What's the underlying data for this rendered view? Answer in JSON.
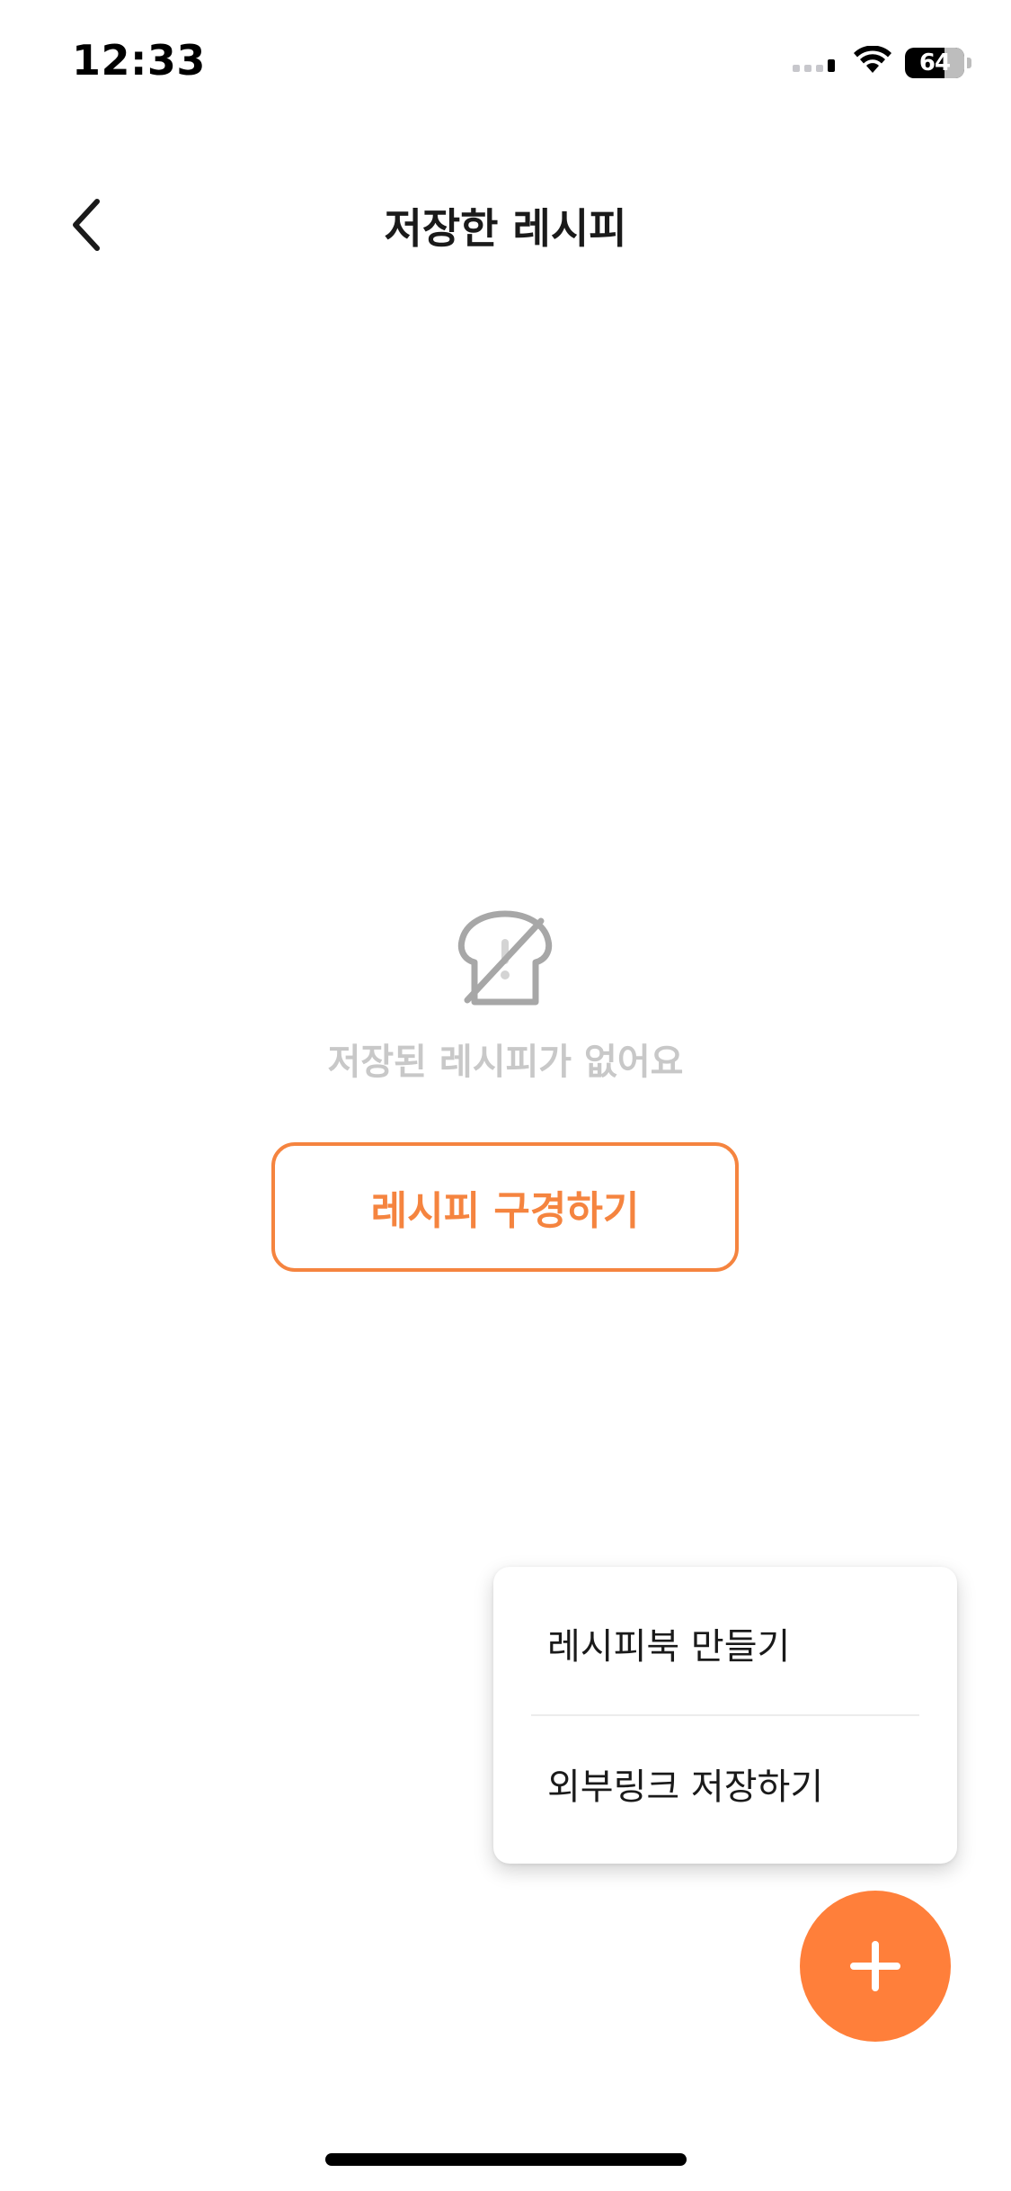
{
  "status_bar": {
    "time": "12:33",
    "battery": "64"
  },
  "nav": {
    "title": "저장한 레시피"
  },
  "empty_state": {
    "message": "저장된 레시피가 없어요",
    "button_label": "레시피 구경하기"
  },
  "popup_menu": {
    "items": [
      {
        "label": "레시피북 만들기"
      },
      {
        "label": "외부링크 저장하기"
      }
    ]
  },
  "icons": {
    "back": "chevron-left-icon",
    "empty": "bread-no-recipe-icon",
    "fab": "plus-icon",
    "wifi": "wifi-icon",
    "signal": "cellular-signal-icon",
    "battery": "battery-icon"
  },
  "colors": {
    "accent": "#f5843f",
    "fab": "#ff7f3a",
    "muted_text": "#c8c8c8",
    "icon_gray": "#a7a7a7"
  }
}
